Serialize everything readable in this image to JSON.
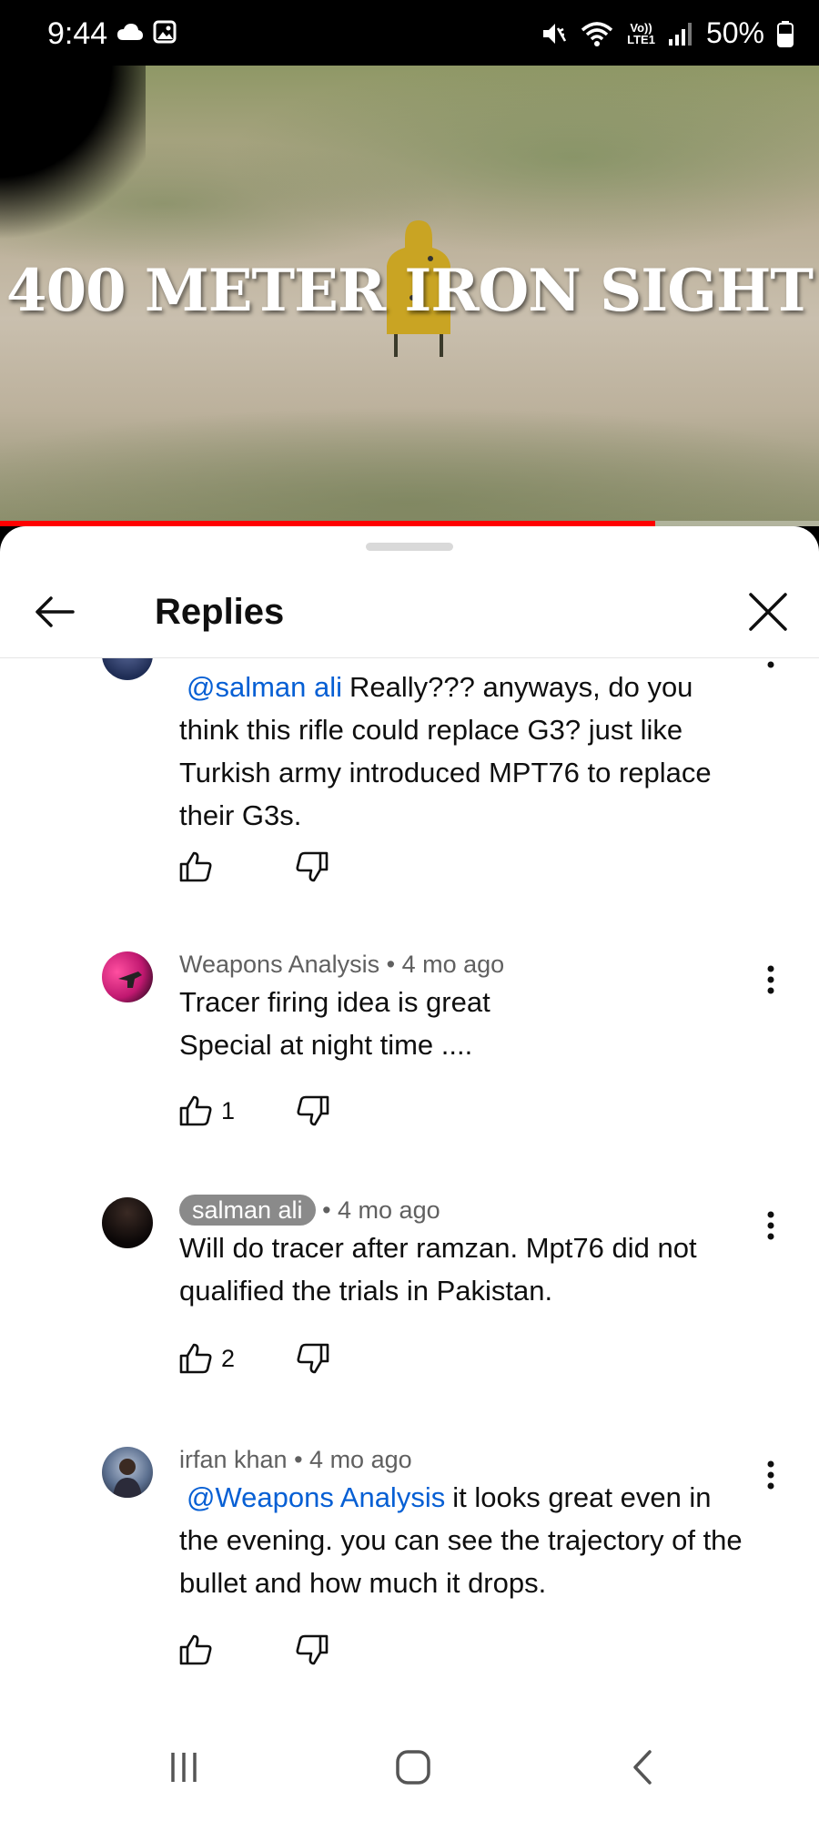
{
  "status_bar": {
    "time": "9:44",
    "network_label_top": "Vo))",
    "network_label_bottom": "LTE1",
    "battery": "50%"
  },
  "video": {
    "overlay_title": "400 METER IRON SIGHT",
    "progress_percent": 80
  },
  "sheet": {
    "title": "Replies"
  },
  "comments": [
    {
      "author": "",
      "time": "",
      "mention": "@salman ali",
      "text": "Really??? anyways, do you think this rifle could replace G3? just like Turkish army introduced MPT76 to replace their G3s.",
      "likes": ""
    },
    {
      "author": "Weapons Analysis",
      "time": "• 4 mo ago",
      "mention": "",
      "text_lines": [
        "Tracer firing idea is great",
        "Special at night time ...."
      ],
      "likes": "1"
    },
    {
      "author": "salman ali",
      "time": "• 4 mo ago",
      "mention": "",
      "text": "Will do tracer after ramzan. Mpt76 did not qualified the trials in Pakistan.",
      "likes": "2"
    },
    {
      "author": "irfan khan",
      "time": "• 4 mo ago",
      "mention": "@Weapons Analysis",
      "text": "it looks great even in the evening. you can see the trajectory of the bullet and how much it drops.",
      "likes": ""
    }
  ],
  "icons": {
    "back": "arrow-left-icon",
    "close": "close-icon",
    "like": "thumbs-up-icon",
    "dislike": "thumbs-down-icon",
    "more": "more-vert-icon"
  },
  "colors": {
    "mention": "#065fd4",
    "progress": "#ff0000",
    "author_pill": "#8a8a8a"
  }
}
